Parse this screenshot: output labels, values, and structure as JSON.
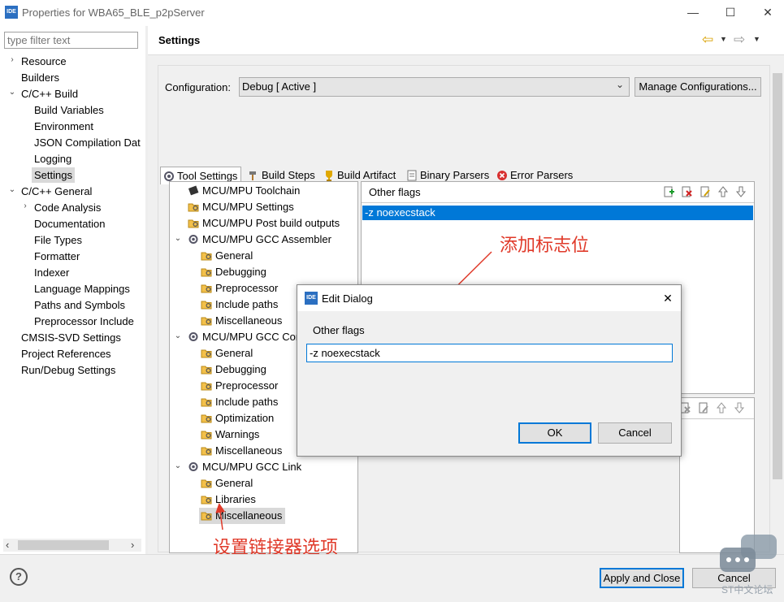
{
  "window": {
    "app_icon_text": "IDE",
    "title": "Properties for WBA65_BLE_p2pServer",
    "minimize": "—",
    "maximize": "☐",
    "close": "✕"
  },
  "left": {
    "filter_placeholder": "type filter text",
    "items": [
      {
        "label": "Resource",
        "toggle": "›"
      },
      {
        "label": "Builders",
        "toggle": ""
      },
      {
        "label": "C/C++ Build",
        "toggle": "⌄"
      },
      {
        "label": "Build Variables",
        "toggle": ""
      },
      {
        "label": "Environment",
        "toggle": ""
      },
      {
        "label": "JSON Compilation Dat",
        "toggle": ""
      },
      {
        "label": "Logging",
        "toggle": ""
      },
      {
        "label": "Settings",
        "toggle": ""
      },
      {
        "label": "C/C++ General",
        "toggle": "⌄"
      },
      {
        "label": "Code Analysis",
        "toggle": "›"
      },
      {
        "label": "Documentation",
        "toggle": ""
      },
      {
        "label": "File Types",
        "toggle": ""
      },
      {
        "label": "Formatter",
        "toggle": ""
      },
      {
        "label": "Indexer",
        "toggle": ""
      },
      {
        "label": "Language Mappings",
        "toggle": ""
      },
      {
        "label": "Paths and Symbols",
        "toggle": ""
      },
      {
        "label": "Preprocessor Include",
        "toggle": ""
      },
      {
        "label": "CMSIS-SVD Settings",
        "toggle": ""
      },
      {
        "label": "Project References",
        "toggle": ""
      },
      {
        "label": "Run/Debug Settings",
        "toggle": ""
      }
    ],
    "scroll_left": "‹",
    "scroll_right": "›"
  },
  "settings": {
    "title": "Settings",
    "nav_back": "⇦",
    "nav_forward": "⇨",
    "config_label": "Configuration:",
    "config_value": "Debug  [ Active ]",
    "manage_button": "Manage Configurations...",
    "tabs": [
      "Tool Settings",
      "Build Steps",
      "Build Artifact",
      "Binary Parsers",
      "Error Parsers"
    ]
  },
  "tool_tree": [
    {
      "label": "MCU/MPU Toolchain",
      "toggle": ""
    },
    {
      "label": "MCU/MPU Settings",
      "toggle": ""
    },
    {
      "label": "MCU/MPU Post build outputs",
      "toggle": ""
    },
    {
      "label": "MCU/MPU GCC Assembler",
      "toggle": "⌄"
    },
    {
      "label": "General",
      "toggle": ""
    },
    {
      "label": "Debugging",
      "toggle": ""
    },
    {
      "label": "Preprocessor",
      "toggle": ""
    },
    {
      "label": "Include paths",
      "toggle": ""
    },
    {
      "label": "Miscellaneous",
      "toggle": ""
    },
    {
      "label": "MCU/MPU GCC Com",
      "toggle": "⌄"
    },
    {
      "label": "General",
      "toggle": ""
    },
    {
      "label": "Debugging",
      "toggle": ""
    },
    {
      "label": "Preprocessor",
      "toggle": ""
    },
    {
      "label": "Include paths",
      "toggle": ""
    },
    {
      "label": "Optimization",
      "toggle": ""
    },
    {
      "label": "Warnings",
      "toggle": ""
    },
    {
      "label": "Miscellaneous",
      "toggle": ""
    },
    {
      "label": "MCU/MPU GCC Link",
      "toggle": "⌄"
    },
    {
      "label": "General",
      "toggle": ""
    },
    {
      "label": "Libraries",
      "toggle": ""
    },
    {
      "label": "Miscellaneous",
      "toggle": ""
    }
  ],
  "flags_panel": {
    "title": "Other flags",
    "entries": [
      "-z noexecstack"
    ]
  },
  "annotations": {
    "add_flag": "添加标志位",
    "linker_option": "设置链接器选项"
  },
  "dialog": {
    "icon_text": "IDE",
    "title": "Edit Dialog",
    "close": "✕",
    "label": "Other flags",
    "value": "-z noexecstack",
    "ok": "OK",
    "cancel": "Cancel"
  },
  "footer": {
    "help": "?",
    "apply_close": "Apply and Close",
    "cancel": "Cancel",
    "watermark": "ST中文论坛"
  }
}
